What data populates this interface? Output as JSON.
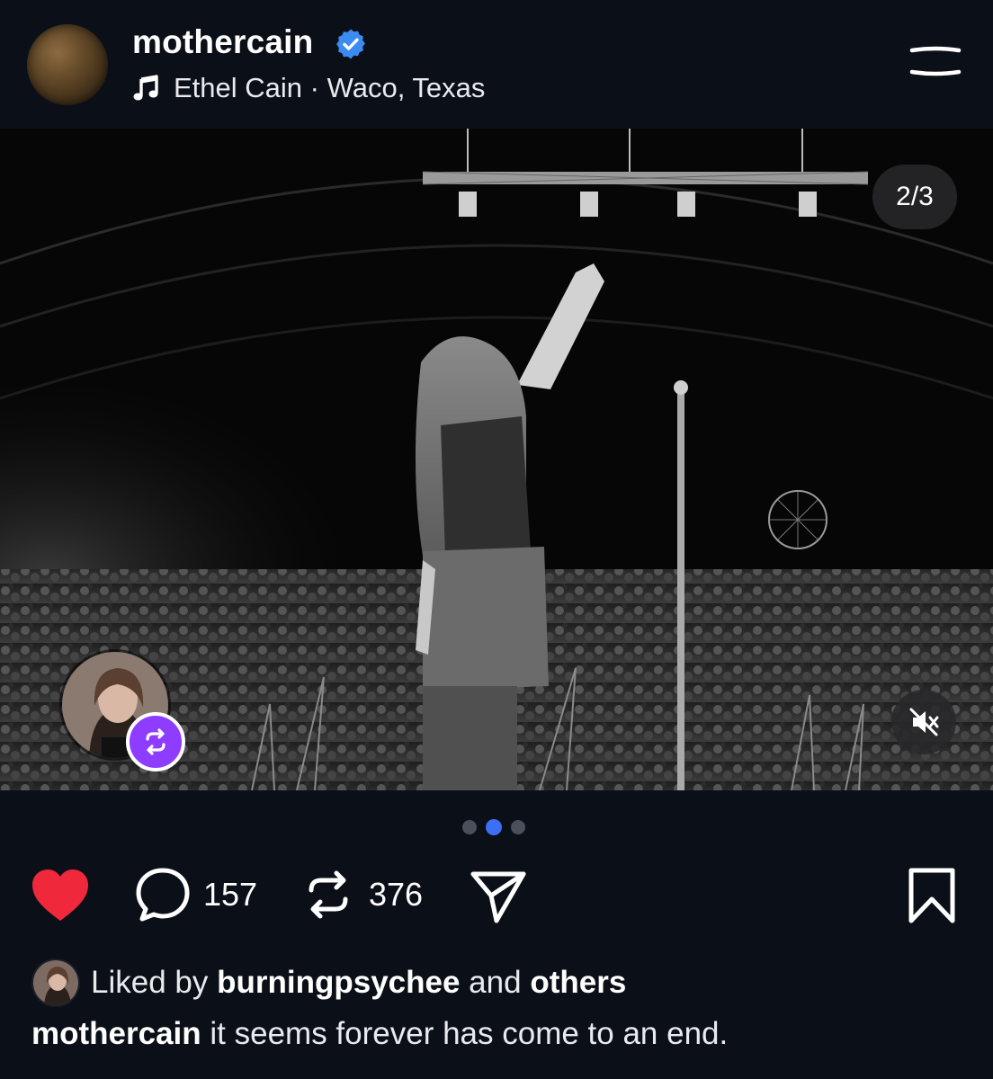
{
  "header": {
    "username": "mothercain",
    "music_icon": "music-note-icon",
    "artist": "Ethel Cain",
    "separator": "·",
    "location": "Waco, Texas",
    "menu_icon": "menu-icon"
  },
  "media": {
    "counter": "2/3",
    "mute_icon": "speaker-muted-icon",
    "repost_badge_icon": "repost-icon",
    "carousel": {
      "total": 3,
      "current": 2
    }
  },
  "actions": {
    "like_icon": "heart-filled-icon",
    "comment_icon": "comment-bubble-icon",
    "comments_count": "157",
    "repost_icon": "repost-icon",
    "reposts_count": "376",
    "share_icon": "send-icon",
    "bookmark_icon": "bookmark-icon"
  },
  "likes": {
    "prefix": "Liked by",
    "user": "burningpsychee",
    "middle": "and",
    "others": "others"
  },
  "caption": {
    "username": "mothercain",
    "text": "it seems forever has come to an end."
  },
  "colors": {
    "background": "#0b1018",
    "verified": "#3b8bf0",
    "like": "#f0283c",
    "repost_badge": "#8e3cff",
    "active_dot": "#3d6ff5"
  }
}
